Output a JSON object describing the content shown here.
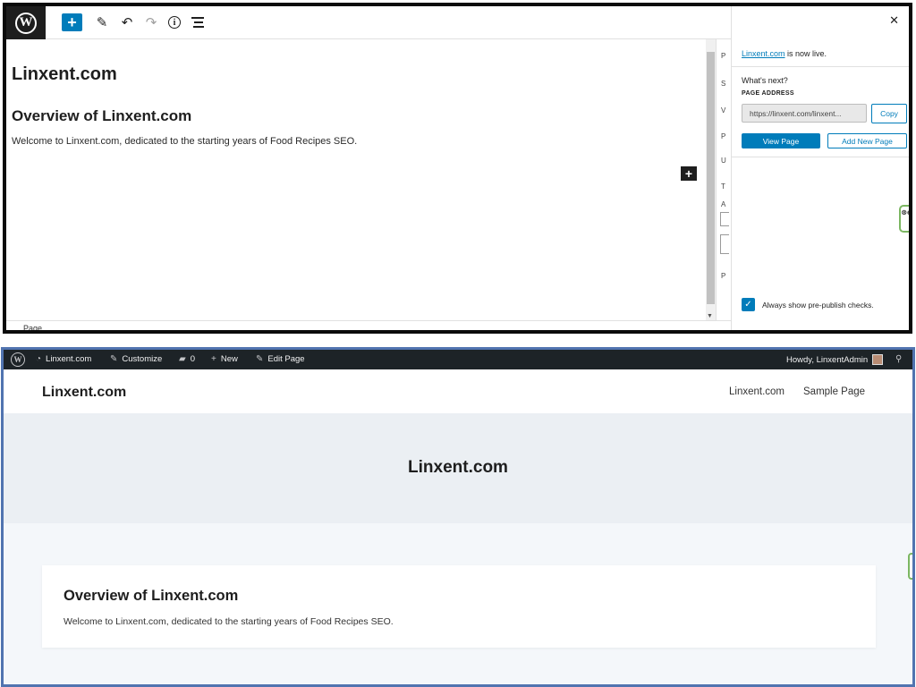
{
  "editor": {
    "canvas": {
      "site_title": "Linxent.com",
      "heading": "Overview of Linxent.com",
      "paragraph": "Welcome to Linxent.com, dedicated to the starting years of Food Recipes SEO."
    },
    "footer": {
      "breadcrumb": "Page"
    },
    "sidebar_strip": [
      "P",
      "S",
      "V",
      "P",
      "U",
      "T",
      "A",
      "P"
    ],
    "post_publish": {
      "live_link": "Linxent.com",
      "live_suffix": " is now live.",
      "whats_next": "What's next?",
      "page_address_label": "PAGE ADDRESS",
      "url_value": "https://linxent.com/linxent...",
      "copy_label": "Copy",
      "view_page_label": "View Page",
      "add_new_page_label": "Add New Page",
      "always_show_label": "Always show pre-publish checks.",
      "always_show_checked": true
    },
    "ext_badge_text": "⊗e"
  },
  "frontend": {
    "admin_bar": {
      "site": "Linxent.com",
      "customize": "Customize",
      "comments_count": "0",
      "new": "New",
      "edit_page": "Edit Page",
      "howdy": "Howdy, LinxentAdmin"
    },
    "header": {
      "site_title": "Linxent.com",
      "nav": [
        "Linxent.com",
        "Sample Page"
      ]
    },
    "hero_title": "Linxent.com",
    "content": {
      "heading": "Overview of Linxent.com",
      "paragraph": "Welcome to Linxent.com, dedicated to the starting years of Food Recipes SEO."
    }
  },
  "colors": {
    "accent": "#007cba",
    "admin_bar": "#1d2327",
    "editor_frame": "#0b0b0b",
    "frontend_frame": "#5174b0",
    "hero_bg": "#ebeff3"
  }
}
